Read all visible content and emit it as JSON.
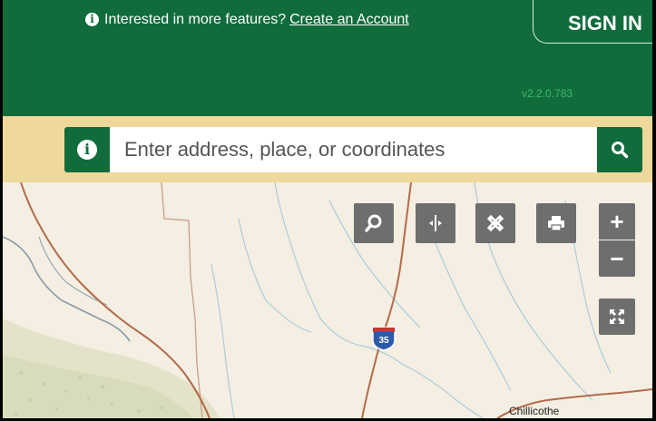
{
  "header": {
    "notice_text": "Interested in more features?",
    "create_account_link": "Create an Account",
    "sign_in_label": "SIGN IN",
    "version": "v2.2.0.783"
  },
  "search": {
    "placeholder": "Enter address, place, or coordinates",
    "value": ""
  },
  "map": {
    "highway_shield": "35",
    "city_label": "Chillicothe",
    "tools": [
      {
        "name": "search-tool",
        "icon": "magnifier-icon"
      },
      {
        "name": "compare-tool",
        "icon": "split-arrows-icon"
      },
      {
        "name": "measure-tool",
        "icon": "ruler-pencil-icon"
      },
      {
        "name": "print-tool",
        "icon": "printer-icon"
      }
    ],
    "zoom_in_label": "+",
    "zoom_out_label": "−"
  },
  "colors": {
    "brand_green": "#116c3c",
    "search_band": "#efd89b",
    "version_text": "#3fb76c",
    "tool_button": "#6e6e6e"
  }
}
